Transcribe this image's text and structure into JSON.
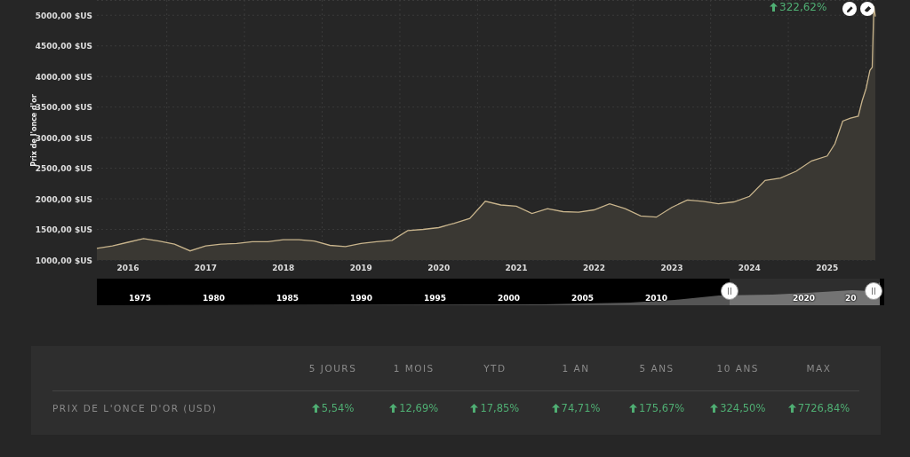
{
  "chart": {
    "change": {
      "text": "322,62%"
    },
    "chart_data": {
      "type": "area",
      "grid": true,
      "ylabel": "Prix de l'once d'or",
      "xlim": [
        2015.6,
        2025.62
      ],
      "ylim": [
        1000,
        5250
      ],
      "xticks": [
        2016,
        2017,
        2018,
        2019,
        2020,
        2021,
        2022,
        2023,
        2024,
        2025
      ],
      "yticks": [
        {
          "value": 1000,
          "label": "1000,00 $US"
        },
        {
          "value": 1500,
          "label": "1500,00 $US"
        },
        {
          "value": 2000,
          "label": "2000,00 $US"
        },
        {
          "value": 2500,
          "label": "2500,00 $US"
        },
        {
          "value": 3000,
          "label": "3000,00 $US"
        },
        {
          "value": 3500,
          "label": "3500,00 $US"
        },
        {
          "value": 4000,
          "label": "4000,00 $US"
        },
        {
          "value": 4500,
          "label": "4500,00 $US"
        },
        {
          "value": 5000,
          "label": "5000,00 $US"
        }
      ],
      "x": [
        2015.6,
        2015.8,
        2016.0,
        2016.2,
        2016.4,
        2016.6,
        2016.8,
        2017.0,
        2017.2,
        2017.4,
        2017.6,
        2017.8,
        2018.0,
        2018.2,
        2018.4,
        2018.6,
        2018.8,
        2019.0,
        2019.2,
        2019.4,
        2019.6,
        2019.8,
        2020.0,
        2020.2,
        2020.4,
        2020.6,
        2020.8,
        2021.0,
        2021.2,
        2021.4,
        2021.6,
        2021.8,
        2022.0,
        2022.2,
        2022.4,
        2022.6,
        2022.8,
        2023.0,
        2023.2,
        2023.4,
        2023.6,
        2023.8,
        2024.0,
        2024.2,
        2024.4,
        2024.6,
        2024.8,
        2025.0,
        2025.1,
        2025.2,
        2025.3,
        2025.4,
        2025.45,
        2025.5,
        2025.55,
        2025.58,
        2025.6,
        2025.62
      ],
      "series": [
        {
          "color": "#c8b48c",
          "values": [
            1190,
            1230,
            1290,
            1350,
            1310,
            1260,
            1150,
            1230,
            1260,
            1270,
            1300,
            1300,
            1330,
            1330,
            1310,
            1240,
            1220,
            1270,
            1300,
            1320,
            1480,
            1500,
            1530,
            1600,
            1680,
            1960,
            1900,
            1880,
            1760,
            1840,
            1790,
            1780,
            1820,
            1920,
            1840,
            1720,
            1700,
            1860,
            1980,
            1960,
            1920,
            1950,
            2040,
            2300,
            2340,
            2450,
            2620,
            2700,
            2900,
            3270,
            3320,
            3350,
            3600,
            3800,
            4100,
            4150,
            5150,
            4980
          ]
        }
      ]
    }
  },
  "navigator": {
    "labels": [
      "1975",
      "1980",
      "1985",
      "1990",
      "1995",
      "2000",
      "2005",
      "2010",
      "2020",
      "20"
    ]
  },
  "stats": {
    "columns": [
      "5 JOURS",
      "1 MOIS",
      "YTD",
      "1 AN",
      "5 ANS",
      "10 ANS",
      "MAX"
    ],
    "rows": [
      {
        "label": "PRIX DE L'ONCE D'OR (USD)",
        "values": [
          "5,54%",
          "12,69%",
          "17,85%",
          "74,71%",
          "175,67%",
          "324,50%",
          "7726,84%"
        ]
      }
    ]
  }
}
